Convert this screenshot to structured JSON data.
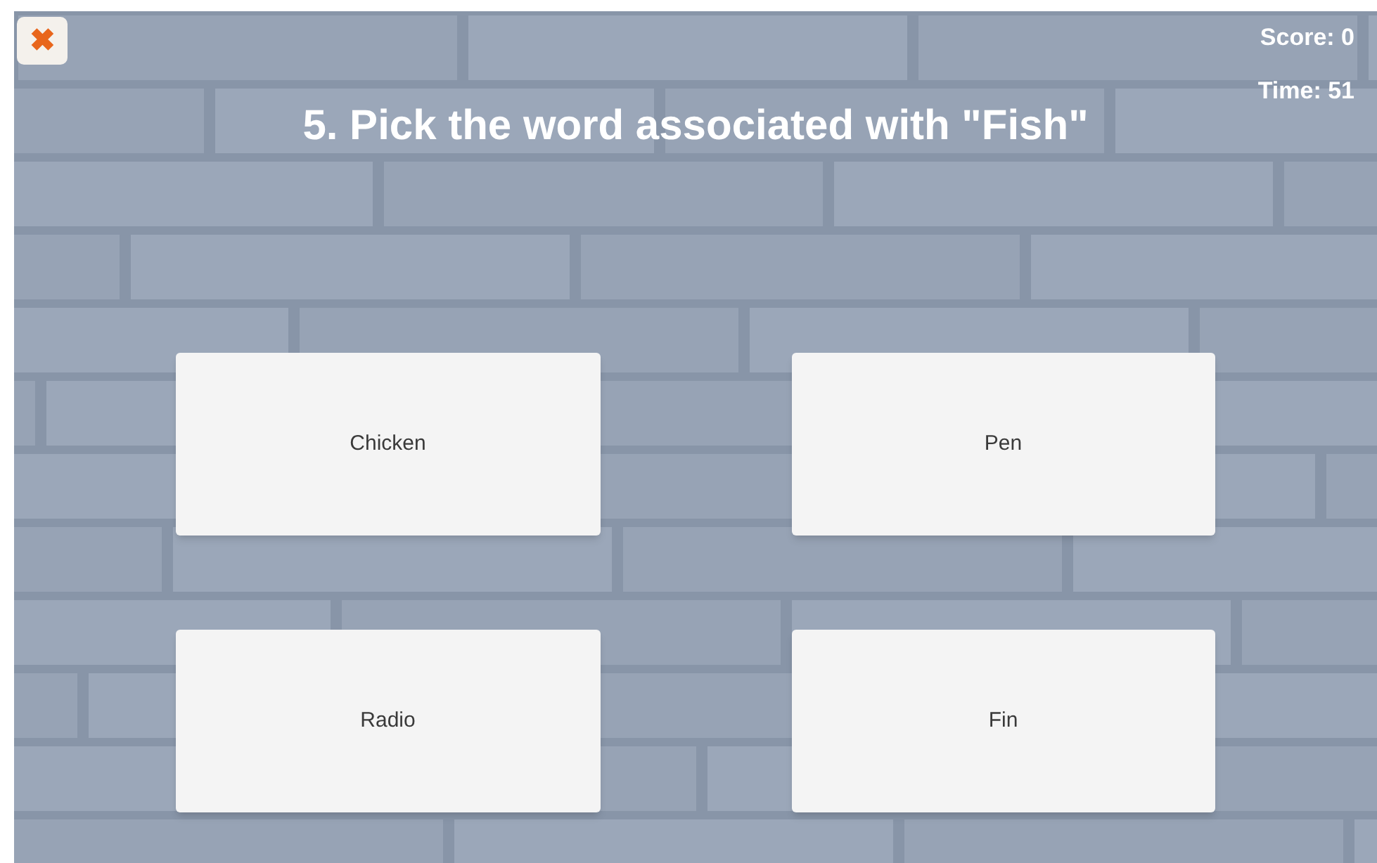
{
  "close_button": {
    "label": "✖"
  },
  "score": "Score: 0",
  "time": "Time: 51",
  "question": "5. Pick the word associated with \"Fish\"",
  "answers": [
    {
      "label": "Chicken"
    },
    {
      "label": "Pen"
    },
    {
      "label": "Radio"
    },
    {
      "label": "Fin"
    }
  ]
}
